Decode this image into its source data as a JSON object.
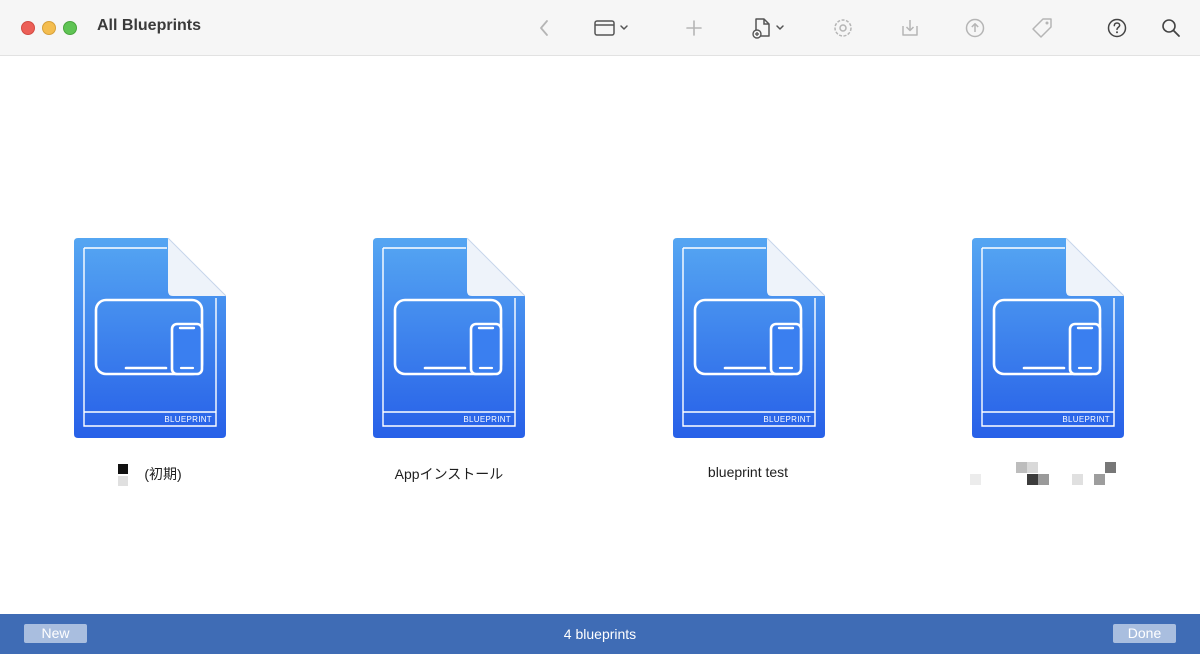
{
  "window": {
    "title": "All Blueprints"
  },
  "toolbar": {
    "icons": [
      "back-chevron-icon",
      "window-view-icon",
      "add-icon",
      "new-document-icon",
      "gear-icon",
      "import-icon",
      "export-icon",
      "tag-icon",
      "help-icon",
      "search-icon"
    ]
  },
  "blueprints": [
    {
      "name": "(初期)",
      "badge": "BLUEPRINT"
    },
    {
      "name": "Appインストール",
      "badge": "BLUEPRINT"
    },
    {
      "name": "blueprint test",
      "badge": "BLUEPRINT"
    },
    {
      "name": "",
      "badge": "BLUEPRINT"
    }
  ],
  "status": {
    "new_label": "New",
    "count_text": "4 blueprints",
    "done_label": "Done"
  },
  "colors": {
    "statusbar": "#3f6cb5",
    "icon_top": "#55a6f2",
    "icon_bottom": "#2760e8"
  }
}
